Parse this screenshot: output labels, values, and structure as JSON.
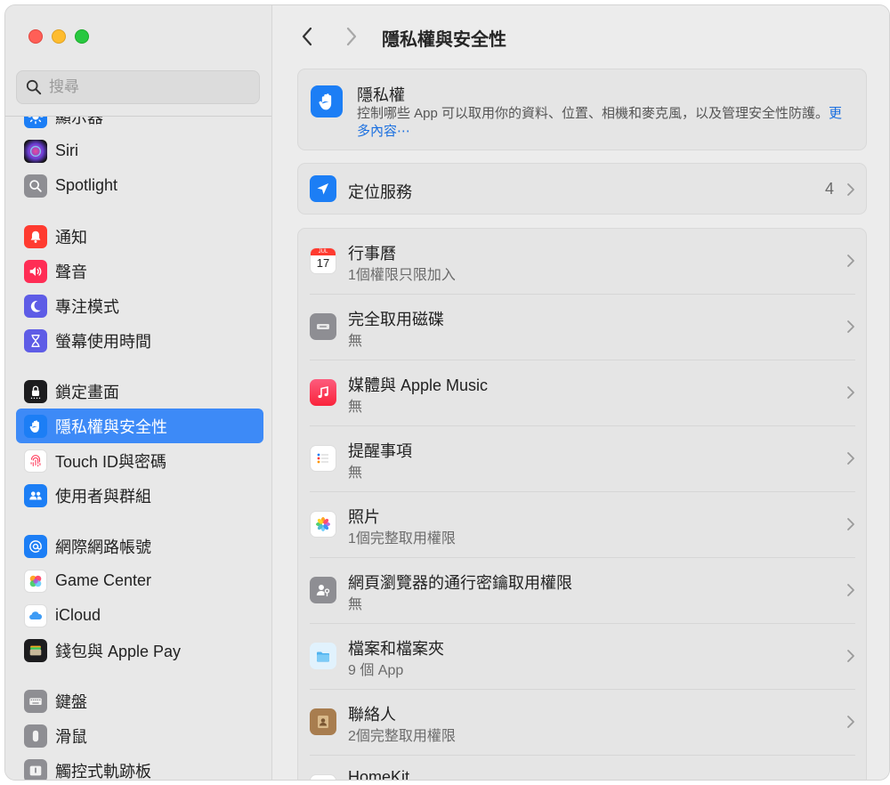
{
  "window": {
    "title": "隱私權與安全性"
  },
  "search": {
    "placeholder": "搜尋"
  },
  "sidebar": {
    "items": [
      {
        "label": "顯示器",
        "icon": "sun-icon",
        "color": "#1c7ef5"
      },
      {
        "label": "Siri",
        "icon": "siri-icon",
        "color": "#5a2d82"
      },
      {
        "label": "Spotlight",
        "icon": "magnifier-icon",
        "color": "#8e8e93"
      },
      {
        "label": "通知",
        "icon": "bell-icon",
        "color": "#ff3b30"
      },
      {
        "label": "聲音",
        "icon": "speaker-icon",
        "color": "#ff2d55"
      },
      {
        "label": "專注模式",
        "icon": "moon-icon",
        "color": "#5e5ce6"
      },
      {
        "label": "螢幕使用時間",
        "icon": "hourglass-icon",
        "color": "#5e5ce6"
      },
      {
        "label": "鎖定畫面",
        "icon": "lock-icon",
        "color": "#1c1c1e"
      },
      {
        "label": "隱私權與安全性",
        "icon": "hand-icon",
        "color": "#1c7ef5"
      },
      {
        "label": "Touch ID與密碼",
        "icon": "fingerprint-icon",
        "color": "#ffffff"
      },
      {
        "label": "使用者與群組",
        "icon": "users-icon",
        "color": "#1c7ef5"
      },
      {
        "label": "網際網路帳號",
        "icon": "at-icon",
        "color": "#1c7ef5"
      },
      {
        "label": "Game Center",
        "icon": "game-center-icon",
        "color": "#ffffff"
      },
      {
        "label": "iCloud",
        "icon": "cloud-icon",
        "color": "#ffffff"
      },
      {
        "label": "錢包與 Apple Pay",
        "icon": "wallet-icon",
        "color": "#1c1c1e"
      },
      {
        "label": "鍵盤",
        "icon": "keyboard-icon",
        "color": "#8e8e93"
      },
      {
        "label": "滑鼠",
        "icon": "mouse-icon",
        "color": "#8e8e93"
      },
      {
        "label": "觸控式軌跡板",
        "icon": "trackpad-icon",
        "color": "#8e8e93"
      }
    ]
  },
  "main": {
    "hero": {
      "title": "隱私權",
      "description": "控制哪些 App 可以取用你的資料、位置、相機和麥克風，以及管理安全性防護。",
      "more_link": "更多內容⋯"
    },
    "location": {
      "label": "定位服務",
      "count": "4"
    },
    "apps": [
      {
        "title": "行事曆",
        "sub": "1個權限只限加入",
        "icon": "calendar-icon"
      },
      {
        "title": "完全取用磁碟",
        "sub": "無",
        "icon": "disk-icon"
      },
      {
        "title": "媒體與 Apple Music",
        "sub": "無",
        "icon": "music-icon"
      },
      {
        "title": "提醒事項",
        "sub": "無",
        "icon": "reminders-icon"
      },
      {
        "title": "照片",
        "sub": "1個完整取用權限",
        "icon": "photos-icon"
      },
      {
        "title": "網頁瀏覽器的通行密鑰取用權限",
        "sub": "無",
        "icon": "passkey-icon"
      },
      {
        "title": "檔案和檔案夾",
        "sub": "9 個 App",
        "icon": "folder-icon"
      },
      {
        "title": "聯絡人",
        "sub": "2個完整取用權限",
        "icon": "contacts-icon"
      },
      {
        "title": "HomeKit",
        "sub": "",
        "icon": "home-icon"
      }
    ],
    "calendar_icon": {
      "month": "JUL",
      "day": "17"
    }
  },
  "colors": {
    "accent": "#3d8af7",
    "link": "#1a6fe0"
  }
}
